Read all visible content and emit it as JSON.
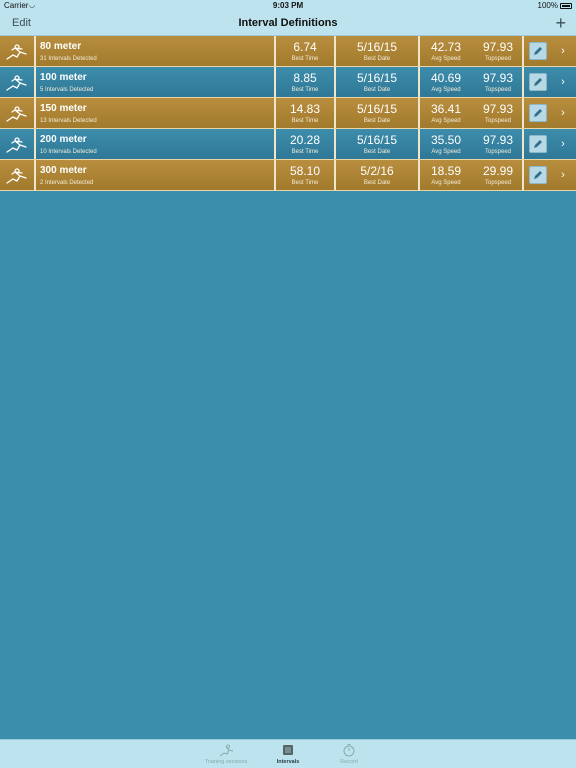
{
  "status": {
    "carrier": "Carrier",
    "time": "9:03 PM",
    "battery": "100%"
  },
  "nav": {
    "edit": "Edit",
    "title": "Interval Definitions",
    "add": "+"
  },
  "labels": {
    "best_time": "Best Time",
    "best_date": "Best Date",
    "avg_speed": "Avg Speed",
    "topspeed": "Topspeed"
  },
  "rows": [
    {
      "name": "80 meter",
      "sub": "31 Intervals Detected",
      "best_time": "6.74",
      "best_date": "5/16/15",
      "avg_speed": "42.73",
      "topspeed": "97.93"
    },
    {
      "name": "100 meter",
      "sub": "5 Intervals Detected",
      "best_time": "8.85",
      "best_date": "5/16/15",
      "avg_speed": "40.69",
      "topspeed": "97.93"
    },
    {
      "name": "150 meter",
      "sub": "13 Intervals Detected",
      "best_time": "14.83",
      "best_date": "5/16/15",
      "avg_speed": "36.41",
      "topspeed": "97.93"
    },
    {
      "name": "200 meter",
      "sub": "10 Intervals Detected",
      "best_time": "20.28",
      "best_date": "5/16/15",
      "avg_speed": "35.50",
      "topspeed": "97.93"
    },
    {
      "name": "300 meter",
      "sub": "2 Intervals Detected",
      "best_time": "58.10",
      "best_date": "5/2/16",
      "avg_speed": "18.59",
      "topspeed": "29.99"
    }
  ],
  "tabs": [
    {
      "label": "Training sessions",
      "icon": "runner-icon"
    },
    {
      "label": "Intervals",
      "icon": "intervals-icon"
    },
    {
      "label": "Record",
      "icon": "stopwatch-icon"
    }
  ],
  "colors": {
    "gold_row": "#b88e3e",
    "blue_row": "#3d8cab",
    "background": "#3b8fad",
    "bar": "#bde3ee"
  }
}
